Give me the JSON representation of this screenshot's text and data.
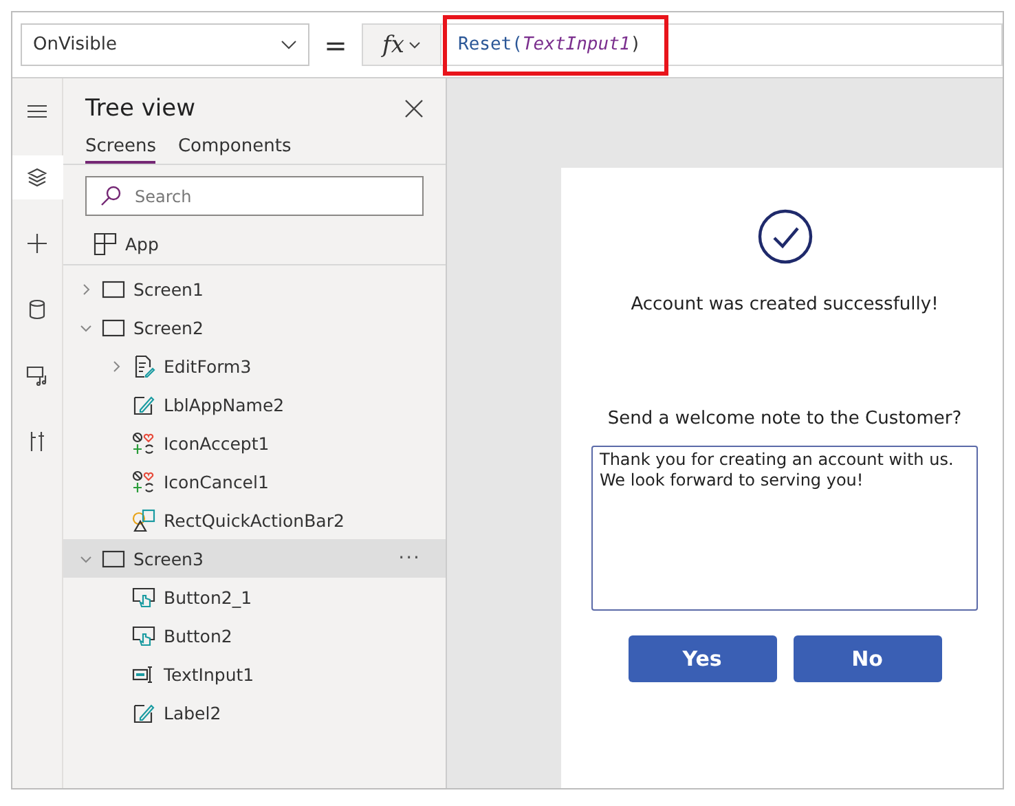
{
  "formula_bar": {
    "property": "OnVisible",
    "equals": "=",
    "fx": "fx",
    "function_name": "Reset(",
    "argument": "TextInput1",
    "closing": ")",
    "highlighted": true
  },
  "rail": [
    {
      "kind": "menu",
      "selected": false
    },
    {
      "kind": "layers",
      "selected": true
    },
    {
      "kind": "add",
      "selected": false
    },
    {
      "kind": "data",
      "selected": false
    },
    {
      "kind": "media",
      "selected": false
    },
    {
      "kind": "tools",
      "selected": false
    }
  ],
  "tree_view": {
    "title": "Tree view",
    "tabs": [
      {
        "label": "Screens",
        "selected": true
      },
      {
        "label": "Components",
        "selected": false
      }
    ],
    "search": {
      "placeholder": "Search"
    },
    "app": {
      "label": "App",
      "kind": "app"
    },
    "items": [
      {
        "label": "Screen1",
        "kind": "screen",
        "expanded": false,
        "selected": false
      },
      {
        "label": "Screen2",
        "kind": "screen",
        "expanded": true,
        "selected": false,
        "children": [
          {
            "label": "EditForm3",
            "kind": "form",
            "expanded": false,
            "selected": false
          },
          {
            "label": "LblAppName2",
            "kind": "label",
            "selected": false
          },
          {
            "label": "IconAccept1",
            "kind": "icon",
            "selected": false
          },
          {
            "label": "IconCancel1",
            "kind": "icon",
            "selected": false
          },
          {
            "label": "RectQuickActionBar2",
            "kind": "shape",
            "selected": false
          }
        ]
      },
      {
        "label": "Screen3",
        "kind": "screen",
        "expanded": true,
        "selected": true,
        "more": "···",
        "children": [
          {
            "label": "Button2_1",
            "kind": "button",
            "selected": false
          },
          {
            "label": "Button2",
            "kind": "button",
            "selected": false
          },
          {
            "label": "TextInput1",
            "kind": "text-input",
            "selected": false
          },
          {
            "label": "Label2",
            "kind": "label",
            "selected": false
          }
        ]
      }
    ]
  },
  "canvas": {
    "message": "Account was created successfully!",
    "question": "Send a welcome note to the Customer?",
    "note": "Thank you for creating an account with us. We look forward to serving you!",
    "buttons": [
      "Yes",
      "No"
    ]
  }
}
